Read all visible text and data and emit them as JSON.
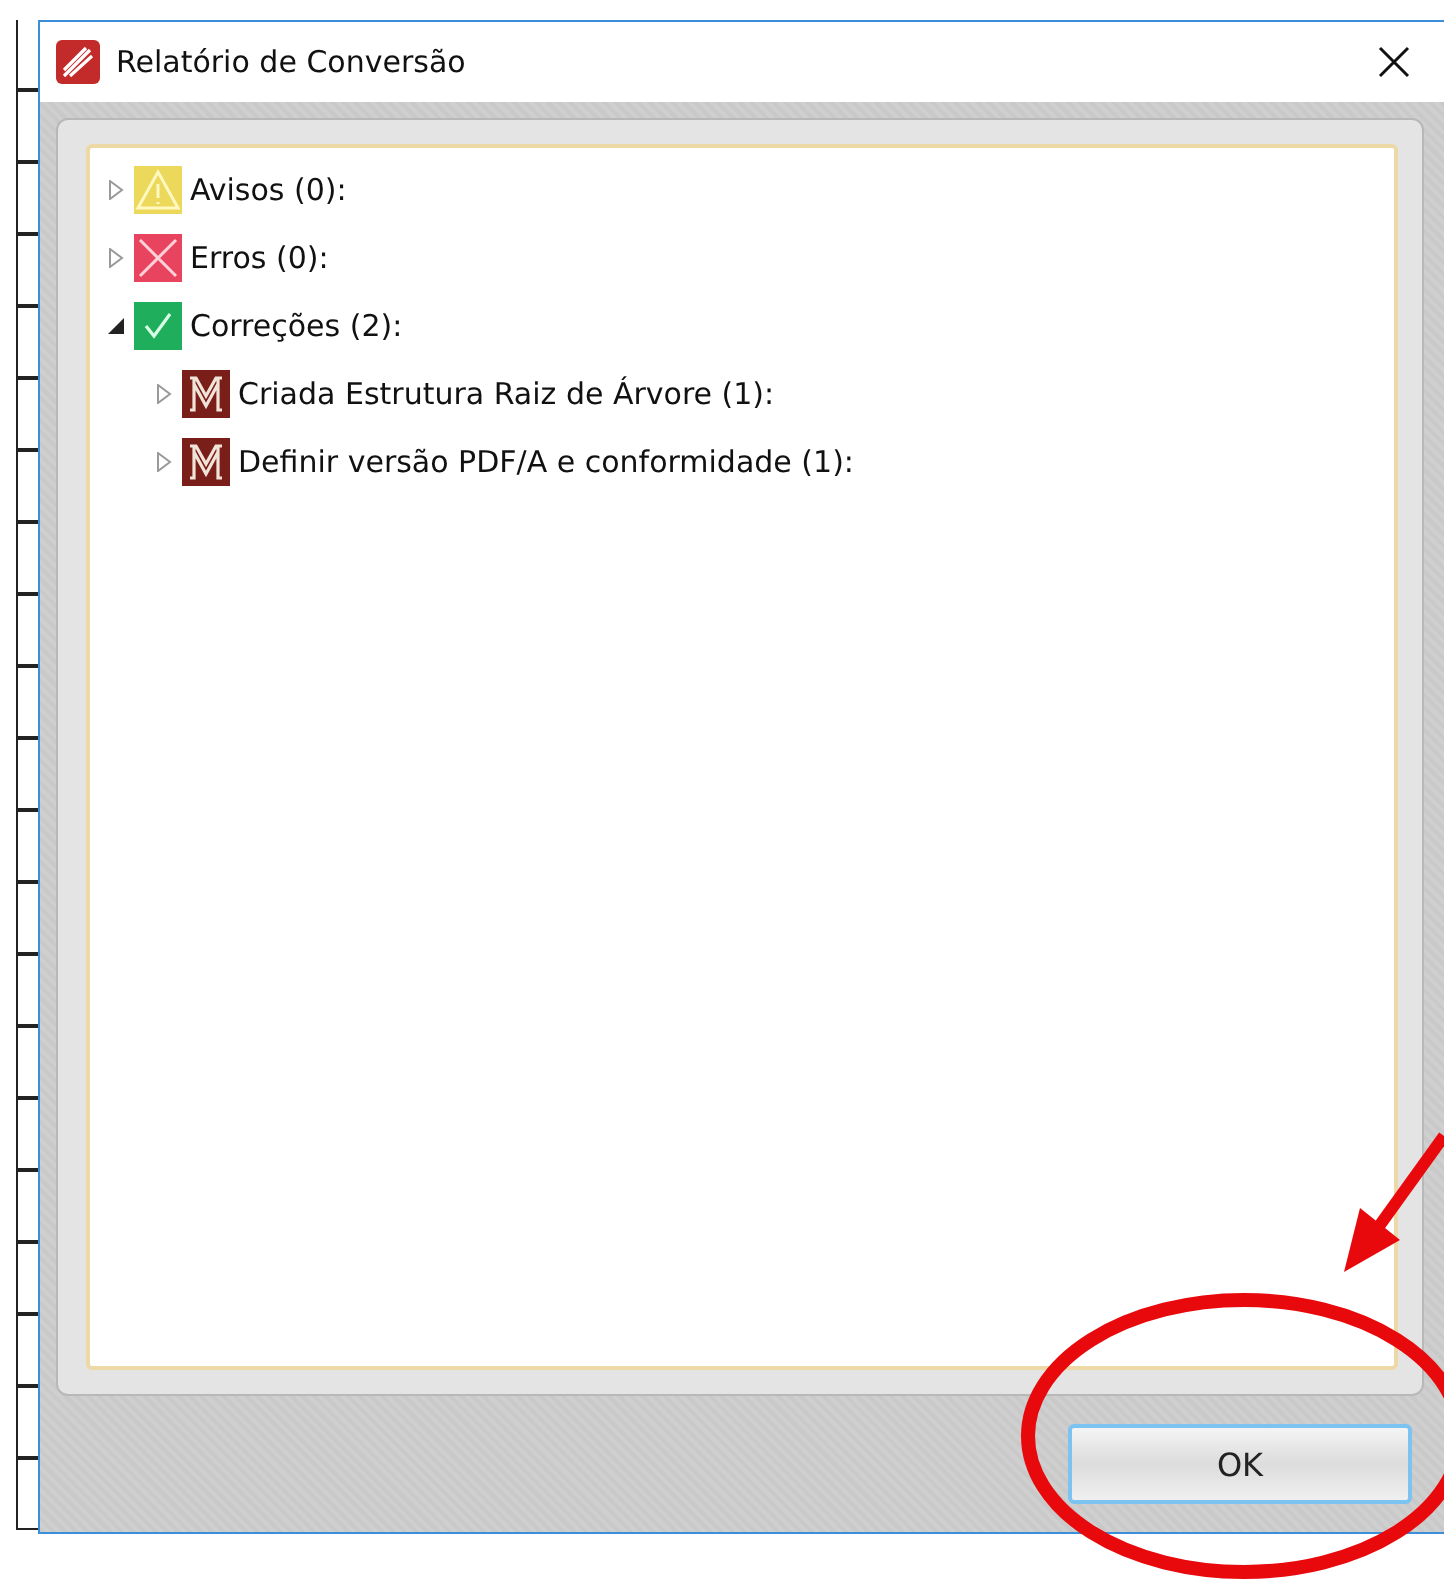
{
  "window": {
    "title": "Relatório de Conversão"
  },
  "tree": [
    {
      "label": "Avisos (0):",
      "kind": "warning",
      "expanded": false
    },
    {
      "label": "Erros (0):",
      "kind": "error",
      "expanded": false
    },
    {
      "label": "Correções (2):",
      "kind": "fix",
      "expanded": true,
      "children": [
        {
          "label": "Criada Estrutura Raiz de Árvore (1):",
          "kind": "marker",
          "expanded": false
        },
        {
          "label": "Definir versão PDF/A e conformidade (1):",
          "kind": "marker",
          "expanded": false
        }
      ]
    }
  ],
  "buttons": [
    {
      "label": "OK"
    }
  ]
}
